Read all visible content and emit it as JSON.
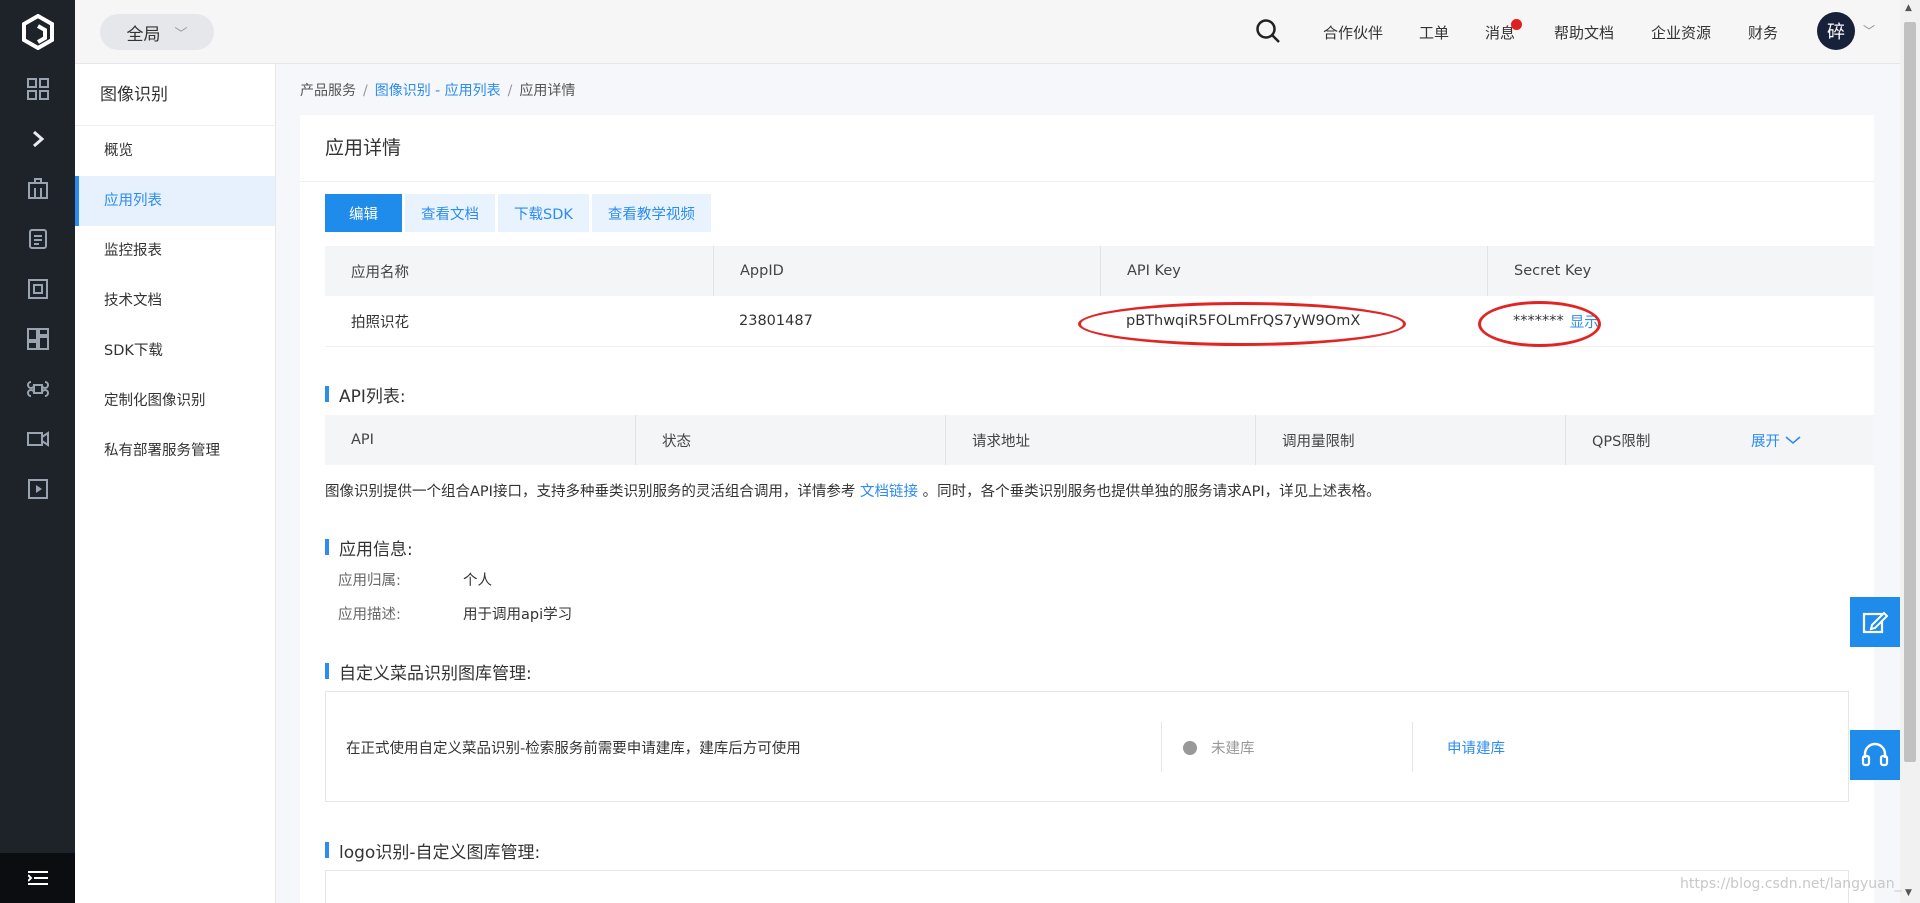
{
  "topbar": {
    "scope": "全局",
    "nav": [
      "合作伙伴",
      "工单",
      "消息",
      "帮助文档",
      "企业资源",
      "财务"
    ],
    "avatar": "碎"
  },
  "rail": {
    "icons": [
      "grid-icon",
      "chevron-right-icon",
      "building-icon",
      "document-icon",
      "frame-icon",
      "dashboard-icon",
      "command-icon",
      "video-icon",
      "play-icon"
    ]
  },
  "sidebar": {
    "title": "图像识别",
    "items": [
      {
        "label": "概览"
      },
      {
        "label": "应用列表",
        "active": true
      },
      {
        "label": "监控报表"
      },
      {
        "label": "技术文档"
      },
      {
        "label": "SDK下载"
      },
      {
        "label": "定制化图像识别"
      },
      {
        "label": "私有部署服务管理"
      }
    ]
  },
  "breadcrumb": {
    "root": "产品服务",
    "sep": "/",
    "link": "图像识别 - 应用列表",
    "current": "应用详情"
  },
  "main": {
    "title": "应用详情",
    "buttons": {
      "edit": "编辑",
      "docs": "查看文档",
      "sdk": "下载SDK",
      "video": "查看教学视频"
    },
    "app_table": {
      "headers": [
        "应用名称",
        "AppID",
        "API Key",
        "Secret Key"
      ],
      "row": {
        "name": "拍照识花",
        "app_id": "23801487",
        "api_key": "pBThwqiR5FOLmFrQS7yW9OmX",
        "secret_masked": "*******",
        "show_link": "显示"
      }
    },
    "api_section": {
      "title": "API列表:",
      "headers": [
        "API",
        "状态",
        "请求地址",
        "调用量限制",
        "QPS限制"
      ],
      "expand": "展开",
      "note_prefix": "图像识别提供一个组合API接口，支持多种垂类识别服务的灵活组合调用，详情参考",
      "note_link": "文档链接",
      "note_suffix": "。同时，各个垂类识别服务也提供单独的服务请求API，详见上述表格。"
    },
    "app_info": {
      "title": "应用信息:",
      "owner_label": "应用归属:",
      "owner_value": "个人",
      "desc_label": "应用描述:",
      "desc_value": "用于调用api学习"
    },
    "dish_library": {
      "title": "自定义菜品识别图库管理:",
      "text": "在正式使用自定义菜品识别-检索服务前需要申请建库，建库后方可使用",
      "status": "未建库",
      "action": "申请建库"
    },
    "logo_library": {
      "title": "logo识别-自定义图库管理:"
    }
  },
  "watermark": "https://blog.csdn.net/langyuan_",
  "colors": {
    "accent": "#2d8cf0",
    "highlight": "#e12525",
    "rail": "#1e2229"
  }
}
